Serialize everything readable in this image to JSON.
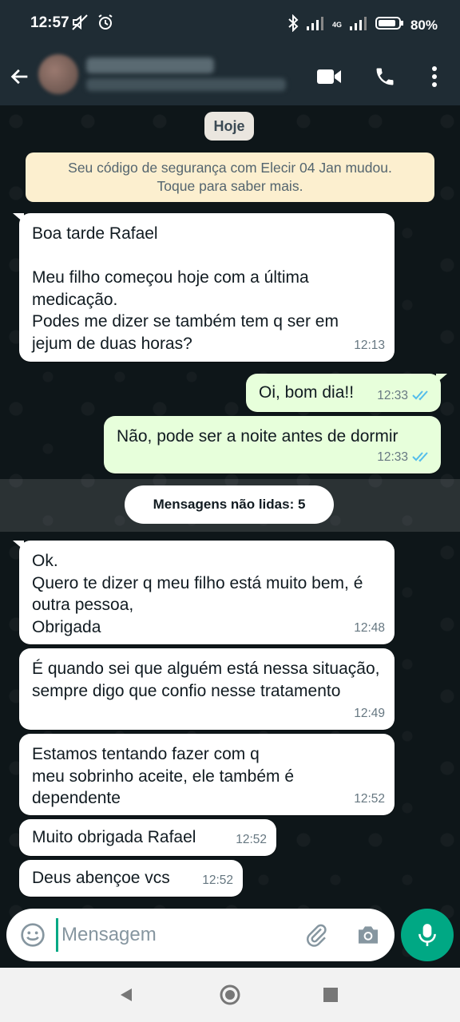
{
  "status_bar": {
    "time": "12:57",
    "battery": "80%",
    "network_label": "4G"
  },
  "header": {
    "contact_name": "",
    "contact_status": ""
  },
  "chat": {
    "date_label": "Hoje",
    "security_notice": "Seu código de segurança com Elecir 04 Jan mudou.\nToque para saber mais.",
    "messages_read": [
      {
        "direction": "in",
        "text": "Boa tarde Rafael\n\nMeu filho começou hoje com a última medicação.\nPodes me dizer se também tem q ser em jejum de duas horas?",
        "time": "12:13"
      },
      {
        "direction": "out",
        "text": "Oi, bom dia!!",
        "time": "12:33",
        "status": "read"
      },
      {
        "direction": "out",
        "text": "Não, pode ser a noite antes de dormir",
        "time": "12:33",
        "status": "read"
      }
    ],
    "unread_label": "Mensagens não lidas: 5",
    "messages_unread": [
      {
        "direction": "in",
        "text": "Ok.\nQuero te dizer q meu filho está muito bem, é outra pessoa,\nObrigada",
        "time": "12:48"
      },
      {
        "direction": "in",
        "text": "É quando sei que alguém está nessa situação, sempre digo que confio nesse tratamento",
        "time": "12:49"
      },
      {
        "direction": "in",
        "text": "Estamos tentando fazer com q\nmeu sobrinho aceite, ele também é dependente",
        "time": "12:52"
      },
      {
        "direction": "in",
        "text": "Muito obrigada Rafael",
        "time": "12:52"
      },
      {
        "direction": "in",
        "text": "Deus abençoe vcs",
        "time": "12:52"
      }
    ]
  },
  "composer": {
    "placeholder": "Mensagem"
  },
  "colors": {
    "header_bg": "#1f2c34",
    "incoming_bubble": "#ffffff",
    "outgoing_bubble": "#e7ffdb",
    "accent": "#00a884",
    "read_ticks": "#53bdeb"
  }
}
